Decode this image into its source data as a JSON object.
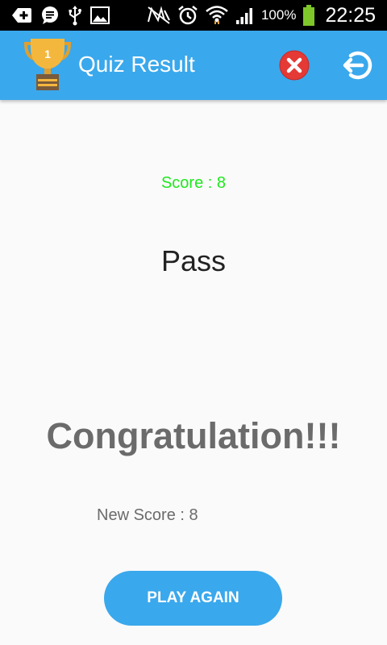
{
  "status_bar": {
    "battery_percent": "100%",
    "time": "22:25",
    "icons": [
      "add-notification-icon",
      "chat-notification-icon",
      "usb-icon",
      "image-notification-icon",
      "nfc-icon",
      "alarm-icon",
      "wifi-icon",
      "signal-icon",
      "battery-icon"
    ]
  },
  "app_bar": {
    "title": "Quiz Result",
    "logo_icon": "trophy-icon",
    "actions": [
      "close-icon",
      "exit-icon"
    ]
  },
  "result": {
    "score_text": "Score : 8",
    "status": "Pass",
    "congrats_message": "Congratulation!!!",
    "new_score_text": "New Score : 8"
  },
  "actions": {
    "play_again_label": "PLAY AGAIN"
  },
  "colors": {
    "primary": "#3aa8ec",
    "score_green": "#1ee81e",
    "close_red": "#e53935",
    "text_gray": "#6b6b6b"
  }
}
